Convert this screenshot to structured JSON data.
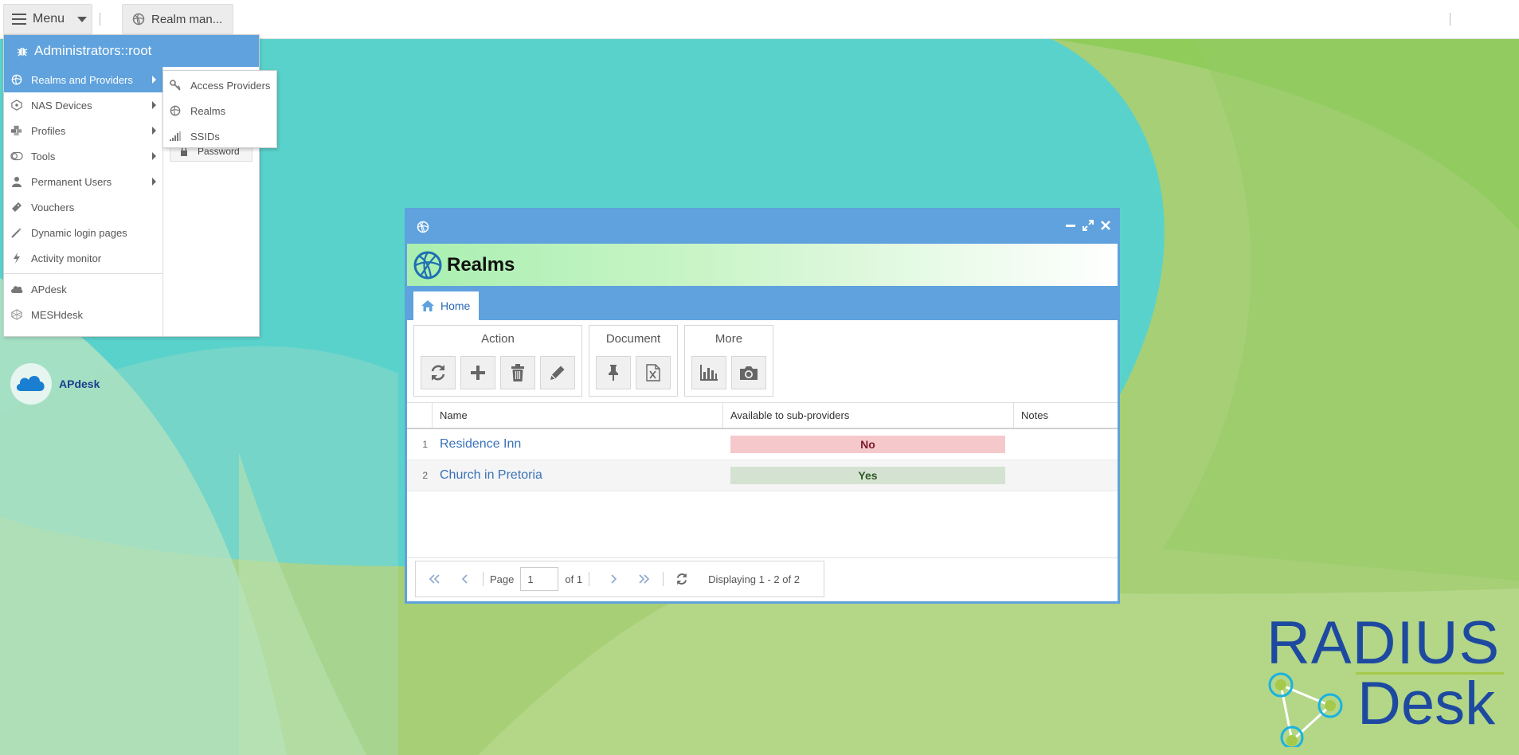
{
  "topbar": {
    "menu_label": "Menu",
    "task_label": "Realm man..."
  },
  "menu": {
    "header": "Administrators::root",
    "items": [
      {
        "label": "Realms and Providers",
        "icon": "realm-icon",
        "has_sub": true,
        "active": true
      },
      {
        "label": "NAS Devices",
        "icon": "nas-icon",
        "has_sub": true
      },
      {
        "label": "Profiles",
        "icon": "profiles-icon",
        "has_sub": true
      },
      {
        "label": "Tools",
        "icon": "tools-icon",
        "has_sub": true
      },
      {
        "label": "Permanent Users",
        "icon": "user-icon",
        "has_sub": true
      },
      {
        "label": "Vouchers",
        "icon": "voucher-icon"
      },
      {
        "label": "Dynamic login pages",
        "icon": "wand-icon"
      },
      {
        "label": "Activity monitor",
        "icon": "bolt-icon"
      }
    ],
    "bottom_items": [
      {
        "label": "APdesk",
        "icon": "cloud-icon"
      },
      {
        "label": "MESHdesk",
        "icon": "mesh-icon"
      }
    ],
    "password_label": "Password"
  },
  "submenu": {
    "items": [
      {
        "label": "Access Providers",
        "icon": "key-icon"
      },
      {
        "label": "Realms",
        "icon": "realm-icon"
      },
      {
        "label": "SSIDs",
        "icon": "signal-icon"
      }
    ]
  },
  "desktop": {
    "shortcut_label": "APdesk"
  },
  "window": {
    "title": "Realms",
    "tab_home": "Home",
    "groups": {
      "action": "Action",
      "document": "Document",
      "more": "More"
    },
    "columns": {
      "name": "Name",
      "available": "Available to sub-providers",
      "notes": "Notes"
    },
    "rows": [
      {
        "num": "1",
        "name": "Residence Inn",
        "available": "No"
      },
      {
        "num": "2",
        "name": "Church in Pretoria",
        "available": "Yes"
      }
    ],
    "pager": {
      "page_label": "Page",
      "page_value": "1",
      "of_label": "of 1",
      "display": "Displaying 1 - 2 of 2"
    }
  },
  "logo": {
    "line1": "RADIUS",
    "line2": "Desk"
  },
  "colors": {
    "accent": "#5fa2dd",
    "no_bg": "#f5c9cc",
    "yes_bg": "#d4e2d2"
  }
}
